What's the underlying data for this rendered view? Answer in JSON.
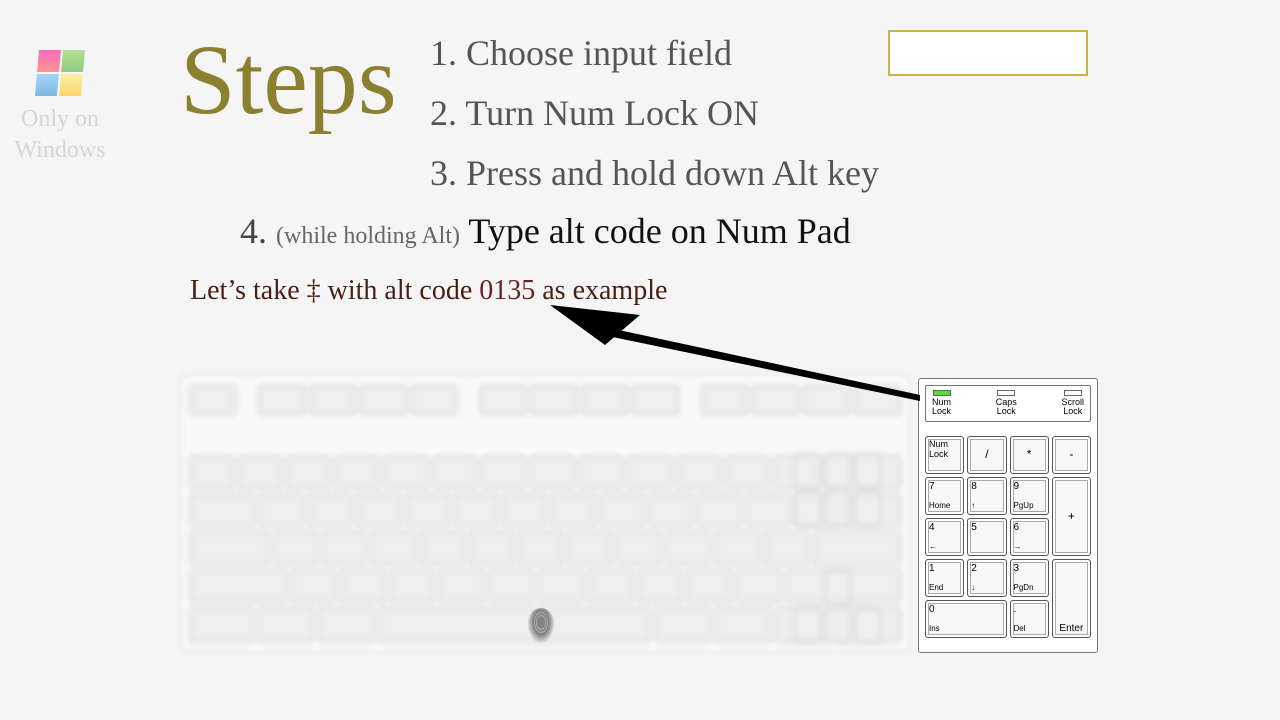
{
  "platform_note": {
    "line1": "Only on",
    "line2": "Windows"
  },
  "steps_title": "Steps",
  "steps": {
    "s1": "1. Choose input field",
    "s2": "2. Turn Num Lock ON",
    "s3": "3. Press and hold down Alt key",
    "s4_num": "4.",
    "s4_paren": "(while holding Alt)",
    "s4_main": "Type alt code on Num Pad"
  },
  "example": {
    "pre": "Let’s take ",
    "char": "‡",
    "mid": " with alt code ",
    "code": "0135",
    "post": " as example"
  },
  "input_value": "",
  "indicators": {
    "num": {
      "label1": "Num",
      "label2": "Lock",
      "on": true
    },
    "caps": {
      "label1": "Caps",
      "label2": "Lock",
      "on": false
    },
    "scroll": {
      "label1": "Scroll",
      "label2": "Lock",
      "on": false
    }
  },
  "numpad": {
    "numlock": "Num Lock",
    "slash": "/",
    "star": "*",
    "minus": "-",
    "plus": "+",
    "enter": "Enter",
    "k7t": "7",
    "k7b": "Home",
    "k8t": "8",
    "k8b": "↑",
    "k9t": "9",
    "k9b": "PgUp",
    "k4t": "4",
    "k4b": "←",
    "k5t": "5",
    "k5b": "",
    "k6t": "6",
    "k6b": "→",
    "k1t": "1",
    "k1b": "End",
    "k2t": "2",
    "k2b": "↓",
    "k3t": "3",
    "k3b": "PgDn",
    "k0t": "0",
    "k0b": "Ins",
    "kdott": ".",
    "kdotb": "Del"
  }
}
